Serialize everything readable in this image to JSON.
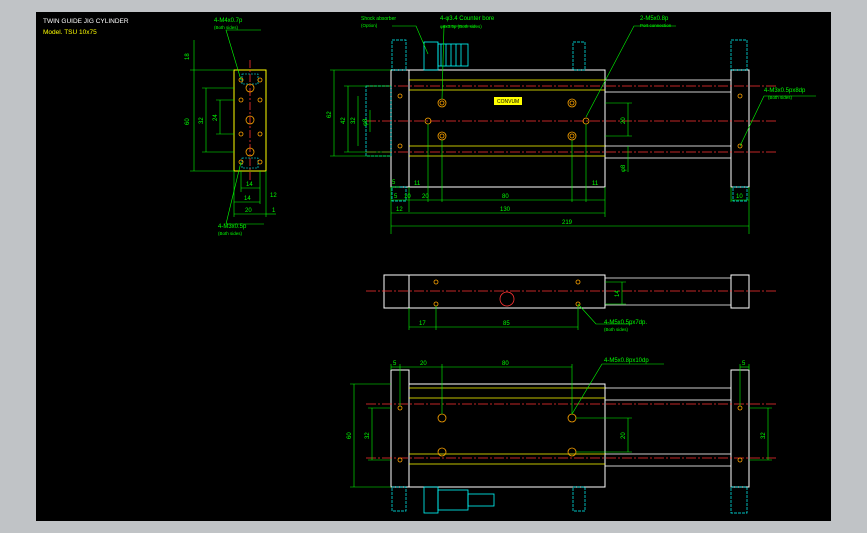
{
  "title": "TWIN GUIDE JIG CYLINDER",
  "model": "Model. TSU 10x75",
  "colors": {
    "background": "#000000",
    "frame": "#c0c3c6",
    "outline": "#ffffff",
    "yellow": "#ffff00",
    "dimension": "#00ff00",
    "centerline": "#ff3333",
    "hidden": "#00ffff",
    "ports": "#ffa500"
  },
  "annotations": {
    "side_top_holes": "4-M4x0.7p",
    "side_top_holes_note": "(Both sides)",
    "side_bottom_holes": "4-M3x0.5p",
    "side_bottom_holes_note": "(Both sides)",
    "shock_absorber": "Shock absorber",
    "shock_absorber_note": "(Option)",
    "counter_bore": "4-φ3.4 Counter bore",
    "counter_bore_size": "φ6x3.5p (Both sides)",
    "port": "2-M5x0.8p",
    "port_note": "Port connection",
    "end_plate_holes": "4-M3x0.5px8dp",
    "end_plate_holes_note": "(Both sides)",
    "top_view_holes": "4-M5x0.5px7dp.",
    "top_view_holes_note": "(Both sides)",
    "bottom_view_holes": "4-M5x0.8px10dp",
    "brand_plate": "CONVUM"
  },
  "dimensions": {
    "side": [
      "18",
      "60",
      "32",
      "24",
      "12",
      "14",
      "20",
      "1"
    ],
    "front": [
      "62",
      "42",
      "32",
      "φ8",
      "5",
      "11",
      "20",
      "80",
      "11",
      "130",
      "12",
      "219",
      "20",
      "φ8",
      "10",
      "5",
      "10"
    ],
    "top": [
      "14",
      "17",
      "85"
    ],
    "bottom": [
      "5",
      "20",
      "80",
      "5",
      "60",
      "32",
      "20",
      "32"
    ]
  }
}
